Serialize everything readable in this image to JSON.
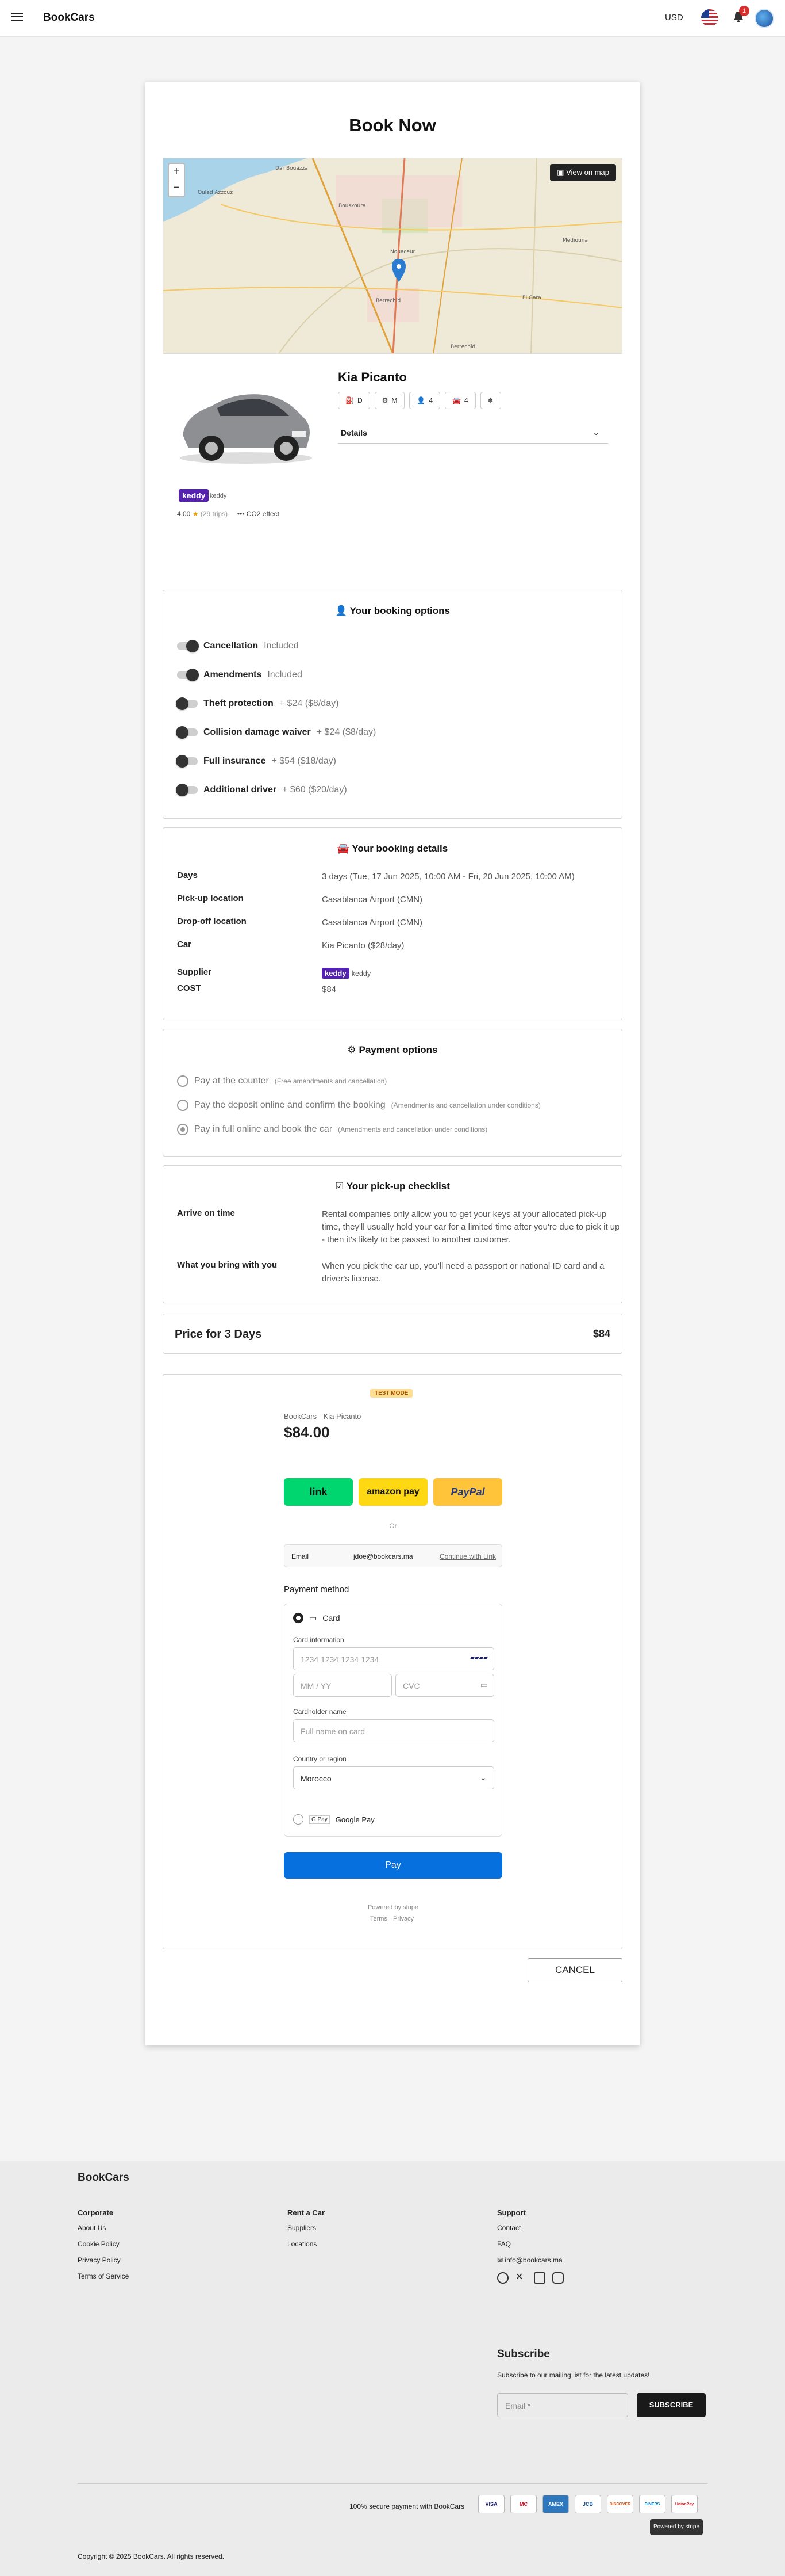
{
  "header": {
    "brand": "BookCars",
    "currency": "USD",
    "notifications_count": "1",
    "icons": [
      "menu-icon",
      "flag-us-icon",
      "bell-icon",
      "avatar-icon"
    ]
  },
  "page": {
    "title": "Book Now"
  },
  "map": {
    "view_on_map": "View on map",
    "zoom_in": "+",
    "zoom_out": "−",
    "places": [
      "Dar Bouazza",
      "Ouled Azzouz",
      "Bouskoura",
      "Nouaceur",
      "Berrechid",
      "Mediouna",
      "El Gara",
      "Berrechid"
    ]
  },
  "car": {
    "name": "Kia Picanto",
    "specs": [
      {
        "icon": "fuel-icon",
        "value": "D"
      },
      {
        "icon": "gearbox-icon",
        "value": "M"
      },
      {
        "icon": "seats-icon",
        "value": "4"
      },
      {
        "icon": "doors-icon",
        "value": "4"
      },
      {
        "icon": "ac-icon",
        "value": ""
      }
    ],
    "details_label": "Details",
    "supplier_logo_text": "keddy",
    "supplier_name": "keddy",
    "rating": "4.00",
    "reviews": "(29 trips)",
    "co2": "CO2 effect"
  },
  "booking_options": {
    "title": "Your booking options",
    "items": [
      {
        "label": "Cancellation",
        "extra": "Included",
        "on": true
      },
      {
        "label": "Amendments",
        "extra": "Included",
        "on": true
      },
      {
        "label": "Theft protection",
        "extra": "+ $24 ($8/day)",
        "on": false
      },
      {
        "label": "Collision damage waiver",
        "extra": "+ $24 ($8/day)",
        "on": false
      },
      {
        "label": "Full insurance",
        "extra": "+ $54 ($18/day)",
        "on": false
      },
      {
        "label": "Additional driver",
        "extra": "+ $60 ($20/day)",
        "on": false
      }
    ]
  },
  "booking_details": {
    "title": "Your booking details",
    "rows": [
      {
        "k": "Days",
        "v": "3 days (Tue, 17 Jun 2025, 10:00 AM - Fri, 20 Jun 2025, 10:00 AM)"
      },
      {
        "k": "Pick-up location",
        "v": "Casablanca Airport (CMN)"
      },
      {
        "k": "Drop-off location",
        "v": "Casablanca Airport (CMN)"
      },
      {
        "k": "Car",
        "v": "Kia Picanto ($28/day)"
      },
      {
        "k": "Supplier",
        "v": "keddy"
      },
      {
        "k": "COST",
        "v": "$84"
      }
    ]
  },
  "payment_options": {
    "title": "Payment options",
    "items": [
      {
        "label": "Pay at the counter",
        "note": "(Free amendments and cancellation)",
        "selected": false
      },
      {
        "label": "Pay the deposit online and confirm the booking",
        "note": "(Amendments and cancellation under conditions)",
        "selected": false
      },
      {
        "label": "Pay in full online and book the car",
        "note": "(Amendments and cancellation under conditions)",
        "selected": true
      }
    ]
  },
  "checklist": {
    "title": "Your pick-up checklist",
    "rows": [
      {
        "k": "Arrive on time",
        "v": "Rental companies only allow you to get your keys at your allocated pick-up time, they'll usually hold your car for a limited time after you're due to pick it up - then it's likely to be passed to another customer."
      },
      {
        "k": "What you bring with you",
        "v": "When you pick the car up, you'll need a passport or national ID card and a driver's license."
      }
    ]
  },
  "price": {
    "label": "Price for 3 Days",
    "value": "$84"
  },
  "stripe": {
    "test_mode": "TEST MODE",
    "merchant": "BookCars - Kia Picanto",
    "amount": "$84.00",
    "wallets": [
      "link",
      "amazon pay",
      "PayPal"
    ],
    "or": "Or",
    "email_label": "Email",
    "email_value": "jdoe@bookcars.ma",
    "continue_link": "Continue with Link",
    "payment_method": "Payment method",
    "card_label": "Card",
    "card_info": "Card information",
    "card_number_ph": "1234 1234 1234 1234",
    "expiry_ph": "MM / YY",
    "cvc_ph": "CVC",
    "cardholder_label": "Cardholder name",
    "cardholder_ph": "Full name on card",
    "country_label": "Country or region",
    "country_value": "Morocco",
    "gpay_label": "Google Pay",
    "pay_button": "Pay",
    "powered": "Powered by stripe",
    "terms": "Terms",
    "privacy": "Privacy"
  },
  "cancel_button": "CANCEL",
  "footer": {
    "brand": "BookCars",
    "corporate": {
      "title": "Corporate",
      "links": [
        "About Us",
        "Cookie Policy",
        "Privacy Policy",
        "Terms of Service"
      ]
    },
    "rent": {
      "title": "Rent a Car",
      "links": [
        "Suppliers",
        "Locations"
      ]
    },
    "support": {
      "title": "Support",
      "links": [
        "Contact",
        "FAQ"
      ],
      "email": "info@bookcars.ma"
    },
    "subscribe": {
      "title": "Subscribe",
      "text": "Subscribe to our mailing list for the latest updates!",
      "placeholder": "Email *",
      "button": "SUBSCRIBE"
    },
    "secure": "100% secure payment with BookCars",
    "cards": [
      "VISA",
      "MC",
      "AMEX",
      "JCB",
      "DISCOVER",
      "DINERS",
      "UnionPay"
    ],
    "powered": "Powered by stripe",
    "copyright": "Copyright © 2025 BookCars. All rights reserved."
  }
}
